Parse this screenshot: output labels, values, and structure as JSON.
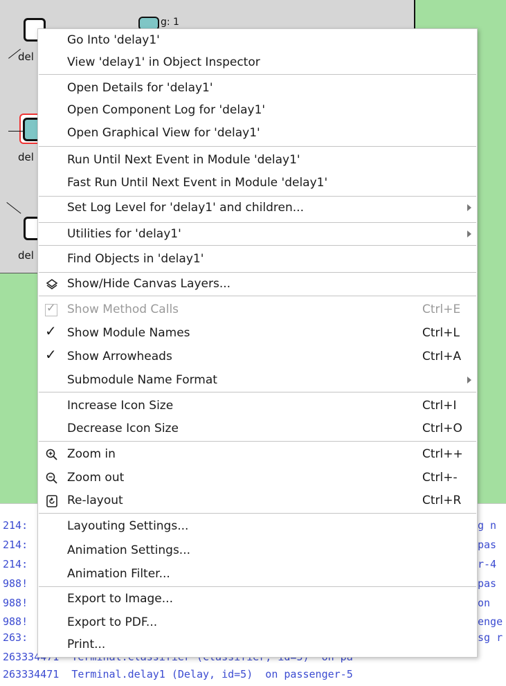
{
  "canvas": {
    "module_names": {
      "delay_top": "del",
      "delay_mid": "del",
      "delay_bottom": "del",
      "top_right_label": "g: 1"
    },
    "colors": {
      "canvas_bg": "#a3df9f",
      "network_bg": "#d6d6d6",
      "selection": "#e33333",
      "module_teal": "#7fc6c6"
    }
  },
  "log": {
    "left_fragments": [
      "214:",
      "214:",
      "214:",
      "988!",
      "988!",
      "988!",
      "263:"
    ],
    "right_fragments": [
      "g n",
      "pas",
      "r-4",
      "pas",
      "on",
      "enge",
      "sg r"
    ],
    "partial_line": "263334471  Terminal.Classifier (Classifier, id=5)  on pa",
    "full_line": "263334471  Terminal.delay1 (Delay, id=5)  on passenger-5",
    "text_color": "#3b4bd1"
  },
  "menu": {
    "items": [
      {
        "label": "Go Into 'delay1'"
      },
      {
        "label": "View 'delay1' in Object Inspector"
      },
      {
        "label": "Open Details for 'delay1'"
      },
      {
        "label": "Open Component Log for 'delay1'"
      },
      {
        "label": "Open Graphical View for 'delay1'"
      },
      {
        "label": "Run Until Next Event in Module 'delay1'"
      },
      {
        "label": "Fast Run Until Next Event in Module 'delay1'"
      },
      {
        "label": "Set Log Level for 'delay1' and children...",
        "submenu": true
      },
      {
        "label": "Utilities for 'delay1'",
        "submenu": true
      },
      {
        "label": "Find Objects in 'delay1'"
      },
      {
        "label": "Show/Hide Canvas Layers...",
        "icon": "layers-icon"
      },
      {
        "label": "Show Method Calls",
        "shortcut": "Ctrl+E",
        "checked": true,
        "disabled": true
      },
      {
        "label": "Show Module Names",
        "shortcut": "Ctrl+L",
        "checked": true
      },
      {
        "label": "Show Arrowheads",
        "shortcut": "Ctrl+A",
        "checked": true
      },
      {
        "label": "Submodule Name Format",
        "submenu": true
      },
      {
        "label": "Increase Icon Size",
        "shortcut": "Ctrl+I"
      },
      {
        "label": "Decrease Icon Size",
        "shortcut": "Ctrl+O"
      },
      {
        "label": "Zoom in",
        "shortcut": "Ctrl++",
        "icon": "zoom-in-icon"
      },
      {
        "label": "Zoom out",
        "shortcut": "Ctrl+-",
        "icon": "zoom-out-icon"
      },
      {
        "label": "Re-layout",
        "shortcut": "Ctrl+R",
        "icon": "relayout-icon"
      },
      {
        "label": "Layouting Settings..."
      },
      {
        "label": "Animation Settings..."
      },
      {
        "label": "Animation Filter..."
      },
      {
        "label": "Export to Image..."
      },
      {
        "label": "Export to PDF..."
      },
      {
        "label": "Print..."
      }
    ]
  }
}
